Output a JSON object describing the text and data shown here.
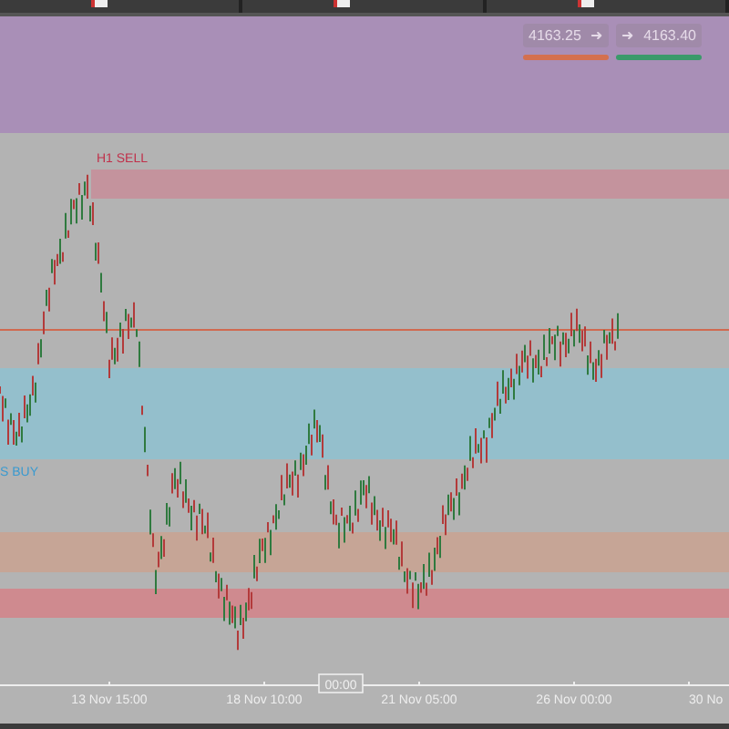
{
  "quote": {
    "sell": {
      "price": "4163.25",
      "arrow": "➜"
    },
    "buy": {
      "price": "4163.40",
      "arrow": "➜"
    }
  },
  "zones": [
    {
      "color": "#a98fb7"
    },
    {
      "color": "#c4939d",
      "label": "H1 SELL"
    },
    {
      "color": "#94bfcc",
      "label": "S BUY"
    },
    {
      "color": "#c6a596"
    },
    {
      "color": "#cf8a8f"
    }
  ],
  "time_axis": {
    "ticks": [
      "13 Nov 15:00",
      "18 Nov 10:00",
      "21 Nov 05:00",
      "26 Nov 00:00",
      "30 No"
    ],
    "cursor": "00:00"
  }
}
